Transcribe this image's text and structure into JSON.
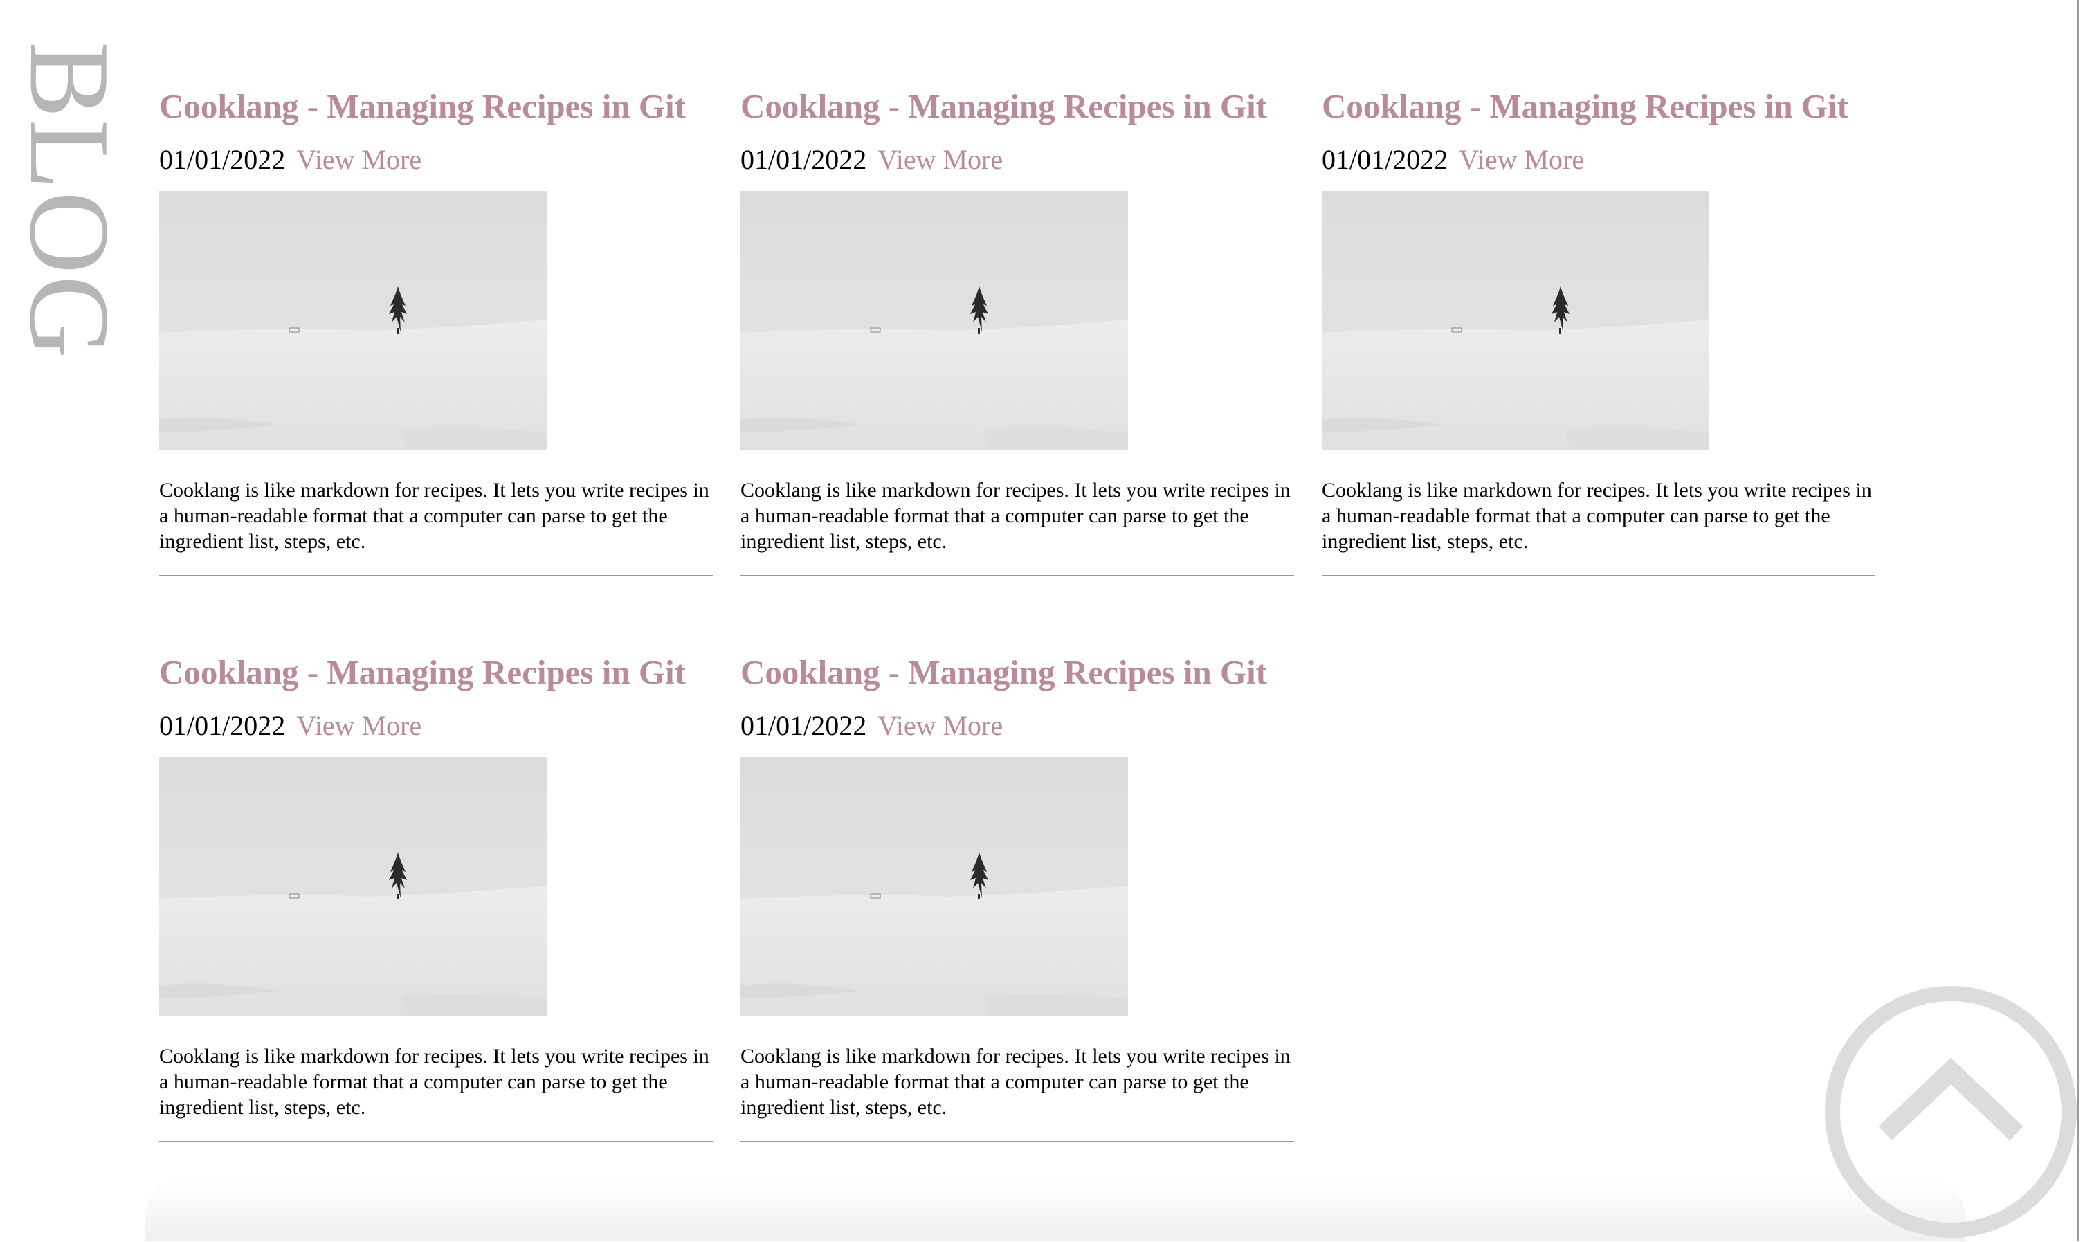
{
  "sidebar": {
    "label": "BLOG"
  },
  "posts": [
    {
      "title": "Cooklang - Managing Recipes in Git",
      "date": "01/01/2022",
      "link_label": "View More",
      "excerpt": "Cooklang is like markdown for recipes. It lets you write recipes in a human-readable format that a computer can parse to get the ingredient list, steps, etc."
    },
    {
      "title": "Cooklang - Managing Recipes in Git",
      "date": "01/01/2022",
      "link_label": "View More",
      "excerpt": "Cooklang is like markdown for recipes. It lets you write recipes in a human-readable format that a computer can parse to get the ingredient list, steps, etc."
    },
    {
      "title": "Cooklang - Managing Recipes in Git",
      "date": "01/01/2022",
      "link_label": "View More",
      "excerpt": "Cooklang is like markdown for recipes. It lets you write recipes in a human-readable format that a computer can parse to get the ingredient list, steps, etc."
    },
    {
      "title": "Cooklang - Managing Recipes in Git",
      "date": "01/01/2022",
      "link_label": "View More",
      "excerpt": "Cooklang is like markdown for recipes. It lets you write recipes in a human-readable format that a computer can parse to get the ingredient list, steps, etc."
    },
    {
      "title": "Cooklang - Managing Recipes in Git",
      "date": "01/01/2022",
      "link_label": "View More",
      "excerpt": "Cooklang is like markdown for recipes. It lets you write recipes in a human-readable format that a computer can parse to get the ingredient list, steps, etc."
    }
  ],
  "thumbnail": {
    "icon": "snowy-tree-landscape-image"
  },
  "back_to_top": {
    "icon": "chevron-up-icon"
  },
  "colors": {
    "accent": "#b88a9c",
    "sidebar_text": "#b6b6b6",
    "divider": "#9a9a9a",
    "back_to_top": "#dcdcdc"
  }
}
